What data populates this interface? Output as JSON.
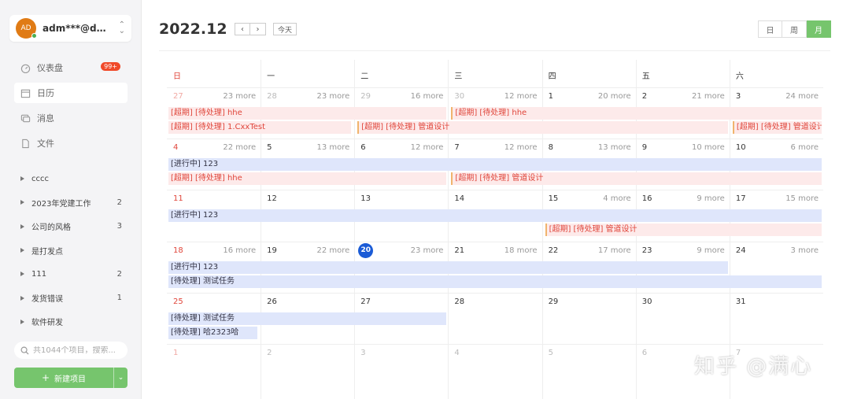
{
  "account": {
    "initials": "AD",
    "name": "adm***@doot..."
  },
  "nav": [
    {
      "label": "仪表盘",
      "badge": "99+"
    },
    {
      "label": "日历"
    },
    {
      "label": "消息"
    },
    {
      "label": "文件"
    }
  ],
  "projects": [
    {
      "name": "cccc",
      "count": ""
    },
    {
      "name": "2023年党建工作",
      "count": "2"
    },
    {
      "name": "公司的风格",
      "count": "3"
    },
    {
      "name": "是打发点",
      "count": ""
    },
    {
      "name": "111",
      "count": "2"
    },
    {
      "name": "发货错误",
      "count": "1"
    },
    {
      "name": "软件研发",
      "count": ""
    }
  ],
  "search": {
    "placeholder": "共1044个项目，搜索..."
  },
  "new_project": {
    "label": "新建项目"
  },
  "header": {
    "month": "2022.12",
    "prev": "‹",
    "next": "›",
    "today": "今天"
  },
  "views": [
    "日",
    "周",
    "月"
  ],
  "active_view": "月",
  "weekdays": [
    "日",
    "一",
    "二",
    "三",
    "四",
    "五",
    "六"
  ],
  "weeks": [
    [
      {
        "d": "27",
        "out": true,
        "more": "23 more"
      },
      {
        "d": "28",
        "out": true,
        "more": "23 more"
      },
      {
        "d": "29",
        "out": true,
        "more": "16 more"
      },
      {
        "d": "30",
        "out": true,
        "more": "12 more"
      },
      {
        "d": "1",
        "more": "20 more"
      },
      {
        "d": "2",
        "more": "21 more"
      },
      {
        "d": "3",
        "more": "24 more"
      }
    ],
    [
      {
        "d": "4",
        "more": "22 more"
      },
      {
        "d": "5",
        "more": "13 more"
      },
      {
        "d": "6",
        "more": "12 more"
      },
      {
        "d": "7",
        "more": "12 more"
      },
      {
        "d": "8",
        "more": "13 more"
      },
      {
        "d": "9",
        "more": "10 more"
      },
      {
        "d": "10",
        "more": "6 more"
      }
    ],
    [
      {
        "d": "11",
        "more": ""
      },
      {
        "d": "12",
        "more": ""
      },
      {
        "d": "13",
        "more": ""
      },
      {
        "d": "14",
        "more": ""
      },
      {
        "d": "15",
        "more": "4 more"
      },
      {
        "d": "16",
        "more": "9 more"
      },
      {
        "d": "17",
        "more": "15 more"
      }
    ],
    [
      {
        "d": "18",
        "more": "16 more"
      },
      {
        "d": "19",
        "more": "22 more"
      },
      {
        "d": "20",
        "today": true,
        "more": "23 more"
      },
      {
        "d": "21",
        "more": "18 more"
      },
      {
        "d": "22",
        "more": "17 more"
      },
      {
        "d": "23",
        "more": "9 more"
      },
      {
        "d": "24",
        "more": "3 more"
      }
    ],
    [
      {
        "d": "25",
        "more": ""
      },
      {
        "d": "26",
        "more": ""
      },
      {
        "d": "27",
        "more": ""
      },
      {
        "d": "28",
        "more": ""
      },
      {
        "d": "29",
        "more": ""
      },
      {
        "d": "30",
        "more": ""
      },
      {
        "d": "31",
        "more": ""
      }
    ],
    [
      {
        "d": "1",
        "out": true,
        "more": ""
      },
      {
        "d": "2",
        "out": true,
        "more": ""
      },
      {
        "d": "3",
        "out": true,
        "more": ""
      },
      {
        "d": "4",
        "out": true,
        "more": ""
      },
      {
        "d": "5",
        "out": true,
        "more": ""
      },
      {
        "d": "6",
        "out": true,
        "more": ""
      },
      {
        "d": "7",
        "out": true,
        "more": ""
      }
    ]
  ],
  "events": [
    {
      "week": 0,
      "row": 0,
      "start": 0,
      "span": 3,
      "text": "[超期] [待处理] hhe",
      "kind": "overdue"
    },
    {
      "week": 0,
      "row": 0,
      "start": 3,
      "span": 4,
      "text": "[超期] [待处理] hhe",
      "kind": "overdue",
      "leftbar": true
    },
    {
      "week": 0,
      "row": 1,
      "start": 0,
      "span": 2,
      "text": "[超期] [待处理] 1.CxxTest",
      "kind": "overdue"
    },
    {
      "week": 0,
      "row": 1,
      "start": 2,
      "span": 4,
      "text": "[超期] [待处理] 管道设计",
      "kind": "overdue",
      "leftbar": true
    },
    {
      "week": 0,
      "row": 1,
      "start": 6,
      "span": 1,
      "text": "[超期] [待处理] 管道设计",
      "kind": "overdue",
      "leftbar": true
    },
    {
      "week": 1,
      "row": 0,
      "start": 0,
      "span": 7,
      "text": "[进行中] 123",
      "kind": "progress"
    },
    {
      "week": 1,
      "row": 1,
      "start": 0,
      "span": 3,
      "text": "[超期] [待处理] hhe",
      "kind": "overdue"
    },
    {
      "week": 1,
      "row": 1,
      "start": 3,
      "span": 4,
      "text": "[超期] [待处理] 管道设计",
      "kind": "overdue",
      "leftbar": true
    },
    {
      "week": 2,
      "row": 0,
      "start": 0,
      "span": 7,
      "text": "[进行中] 123",
      "kind": "progress"
    },
    {
      "week": 2,
      "row": 1,
      "start": 4,
      "span": 3,
      "text": "[超期] [待处理] 管道设计",
      "kind": "overdue",
      "leftbar": true
    },
    {
      "week": 3,
      "row": 0,
      "start": 0,
      "span": 6,
      "text": "[进行中] 123",
      "kind": "progress"
    },
    {
      "week": 3,
      "row": 1,
      "start": 0,
      "span": 7,
      "text": "[待处理] 测试任务",
      "kind": "pending"
    },
    {
      "week": 4,
      "row": 0,
      "start": 0,
      "span": 3,
      "text": "[待处理] 测试任务",
      "kind": "pending"
    },
    {
      "week": 4,
      "row": 1,
      "start": 0,
      "span": 1,
      "text": "[待处理] 哈2323哈",
      "kind": "pending"
    }
  ],
  "watermark": "知乎 @满心",
  "colors": {
    "accent": "#76c56d",
    "overdue_text": "#e0453a",
    "overdue_bg": "#fdeaea",
    "task_bg": "#dfe6fb",
    "today": "#1a5bd6",
    "badge": "#f04a2a"
  }
}
